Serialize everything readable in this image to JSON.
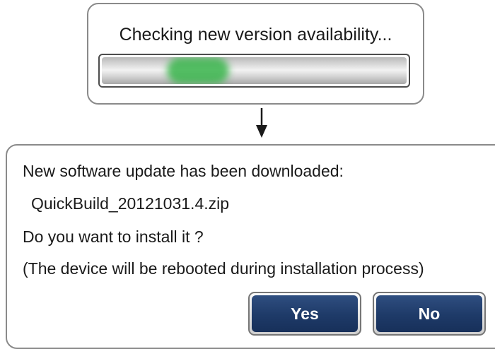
{
  "check_dialog": {
    "message": "Checking new version availability...",
    "progress_indicator": "indeterminate",
    "progress_glow_color": "#38b44a"
  },
  "flow_arrow_icon": "down-arrow-icon",
  "update_dialog": {
    "headline": "New software update has been downloaded:",
    "filename": "QuickBuild_20121031.4.zip",
    "question": "Do you want to install it ?",
    "notice": "(The device will be rebooted during installation process)",
    "buttons": {
      "yes_label": "Yes",
      "no_label": "No"
    },
    "button_color": "#1e3a68"
  }
}
